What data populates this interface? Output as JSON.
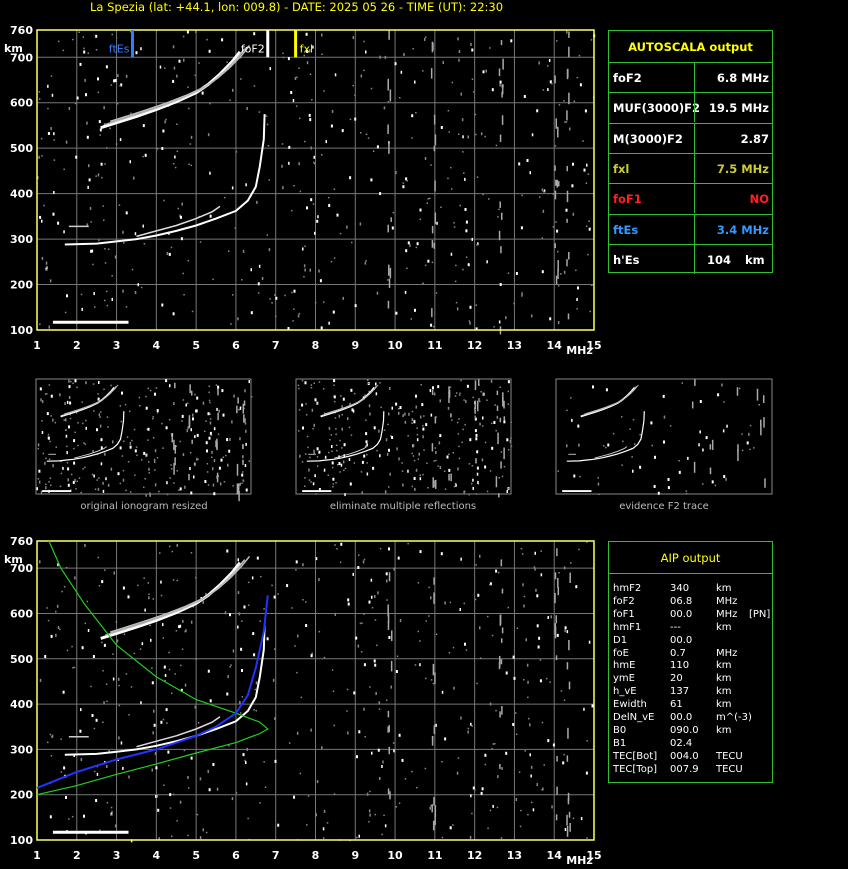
{
  "header": {
    "title": "La Spezia (lat: +44.1, lon: 009.8) - DATE: 2025 05 26 - TIME (UT): 22:30"
  },
  "axes": {
    "x_ticks": [
      "1",
      "2",
      "3",
      "4",
      "5",
      "6",
      "7",
      "8",
      "9",
      "10",
      "11",
      "12",
      "13",
      "14",
      "15"
    ],
    "x_unit": "MHz",
    "y_ticks": [
      "760",
      "700",
      "600",
      "500",
      "400",
      "300",
      "200",
      "100"
    ],
    "y_unit": "km"
  },
  "markers": {
    "ftEs": "ftEs",
    "foF2": "foF2",
    "fxl": "fxl"
  },
  "autoscala": {
    "title": "AUTOSCALA output",
    "rows": [
      {
        "key": "foF2",
        "value": "6.8 MHz",
        "color": "#ffffff"
      },
      {
        "key": "MUF(3000)F2",
        "value": "19.5 MHz",
        "color": "#ffffff"
      },
      {
        "key": "M(3000)F2",
        "value": "2.87",
        "color": "#ffffff"
      },
      {
        "key": "fxl",
        "value": "7.5 MHz",
        "color": "#cccc33"
      },
      {
        "key": "foF1",
        "value": "NO",
        "color": "#ff2020"
      },
      {
        "key": "ftEs",
        "value": "3.4 MHz",
        "color": "#3399ff"
      },
      {
        "key": "h'Es",
        "value": "104",
        "unit": "km",
        "color": "#ffffff"
      }
    ]
  },
  "thumbnails": [
    {
      "caption": "original ionogram resized"
    },
    {
      "caption": "eliminate multiple reflections"
    },
    {
      "caption": "evidence F2 trace"
    }
  ],
  "aip": {
    "title": "AIP output",
    "rows": [
      {
        "name": "hmF2",
        "value": "340",
        "unit": "km",
        "flag": ""
      },
      {
        "name": "foF2",
        "value": "06.8",
        "unit": "MHz",
        "flag": ""
      },
      {
        "name": "foF1",
        "value": "00.0",
        "unit": "MHz",
        "flag": "[PN]"
      },
      {
        "name": "hmF1",
        "value": "---",
        "unit": "km",
        "flag": ""
      },
      {
        "name": "D1",
        "value": "00.0",
        "unit": "",
        "flag": ""
      },
      {
        "name": "foE",
        "value": "0.7",
        "unit": "MHz",
        "flag": ""
      },
      {
        "name": "hmE",
        "value": "110",
        "unit": "km",
        "flag": ""
      },
      {
        "name": "ymE",
        "value": "20",
        "unit": "km",
        "flag": ""
      },
      {
        "name": "h_vE",
        "value": "137",
        "unit": "km",
        "flag": ""
      },
      {
        "name": "Ewidth",
        "value": "61",
        "unit": "km",
        "flag": ""
      },
      {
        "name": "DelN_vE",
        "value": "00.0",
        "unit": "m^(-3)",
        "flag": ""
      },
      {
        "name": "B0",
        "value": "090.0",
        "unit": "km",
        "flag": ""
      },
      {
        "name": "B1",
        "value": "02.4",
        "unit": "",
        "flag": ""
      },
      {
        "name": "TEC[Bot]",
        "value": "004.0",
        "unit": "TECU",
        "flag": ""
      },
      {
        "name": "TEC[Top]",
        "value": "007.9",
        "unit": "TECU",
        "flag": ""
      }
    ]
  },
  "colors": {
    "frame": "#ffff66",
    "grid": "#777777",
    "box_border": "#2fbf2f",
    "ftEs_marker": "#2f7fff",
    "fxl_marker": "#ffff00",
    "foF2_marker": "#ffffff",
    "profile_green": "#22cc22",
    "profile_blue": "#2233ff"
  }
}
